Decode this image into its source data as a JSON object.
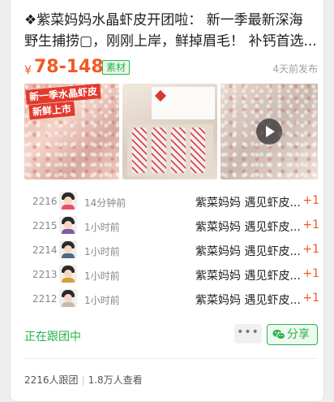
{
  "post": {
    "title_line1": "❖紫菜妈妈水晶虾皮开团啦： 新一季最新深海",
    "title_line2": "野生捕捞▢，刚刚上岸，鲜掉眉毛！ 补钙首选...",
    "price_symbol": "¥",
    "price_range": "78-148",
    "tag": "素材",
    "published": "4天前发布"
  },
  "media": {
    "banner_line1": "新一季水晶虾皮",
    "banner_line2": "新鲜上市"
  },
  "orders": [
    {
      "num": "2216",
      "time": "14分钟前",
      "item": "紫菜妈妈 遇见虾皮...",
      "qty": "+1",
      "avatar_color": "#e84f6a"
    },
    {
      "num": "2215",
      "time": "1小时前",
      "item": "紫菜妈妈 遇见虾皮...",
      "qty": "+1",
      "avatar_color": "#7e5aa8"
    },
    {
      "num": "2214",
      "time": "1小时前",
      "item": "紫菜妈妈 遇见虾皮...",
      "qty": "+1",
      "avatar_color": "#4a6a88"
    },
    {
      "num": "2213",
      "time": "1小时前",
      "item": "紫菜妈妈 遇见虾皮...",
      "qty": "+1",
      "avatar_color": "#d8a03a"
    },
    {
      "num": "2212",
      "time": "1小时前",
      "item": "紫菜妈妈 遇见虾皮...",
      "qty": "+1",
      "avatar_color": "#c8b9ad"
    }
  ],
  "status": "正在跟团中",
  "buttons": {
    "more": "•••",
    "share": "分享"
  },
  "footer": {
    "followers": "2216人跟团",
    "views": "1.8万人查看"
  },
  "colors": {
    "accent": "#f15a22",
    "green": "#2ab24a"
  },
  "icons": {
    "share": "wechat-icon",
    "play": "play-icon"
  }
}
